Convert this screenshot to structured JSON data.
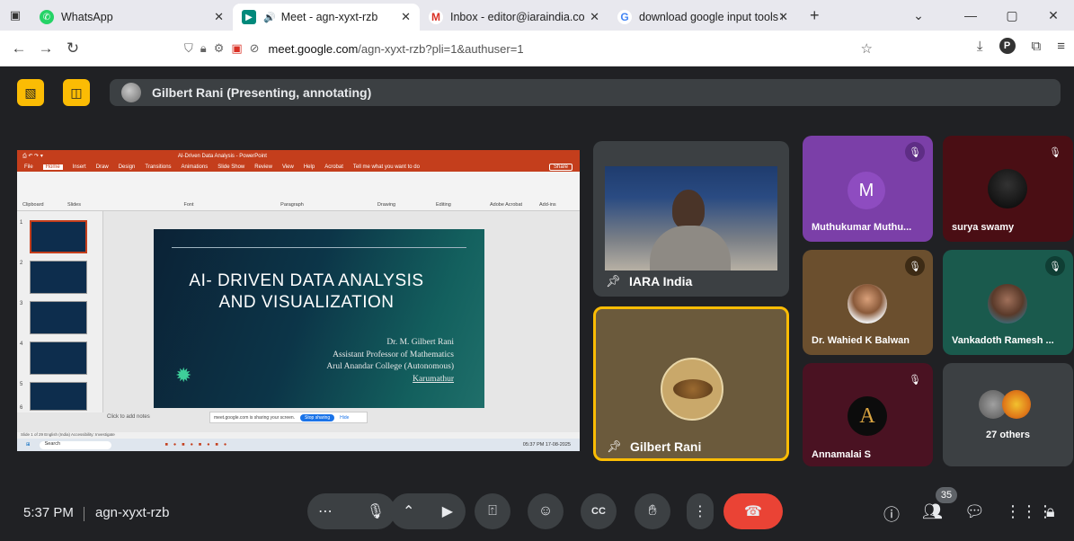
{
  "browser": {
    "tabs": [
      {
        "label": "WhatsApp",
        "active": false
      },
      {
        "label": "Meet - agn-xyxt-rzb",
        "active": true
      },
      {
        "label": "Inbox - editor@iaraindia.com - I",
        "active": false
      },
      {
        "label": "download google input tools ta",
        "active": false
      }
    ],
    "url_host": "meet.google.com",
    "url_path": "/agn-xyxt-rzb?pli=1&authuser=1",
    "profile_initial": "P"
  },
  "meet": {
    "presenter_chip": "Gilbert Rani (Presenting, annotating)",
    "time": "5:37 PM",
    "meeting_code": "agn-xyxt-rzb",
    "participant_count": "35"
  },
  "presentation": {
    "window_title": "AI-Driven Data Analysis - PowerPoint",
    "ribbon_tabs": [
      "File",
      "Home",
      "Insert",
      "Draw",
      "Design",
      "Transitions",
      "Animations",
      "Slide Show",
      "Review",
      "View",
      "Help",
      "Acrobat"
    ],
    "tell_me": "Tell me what you want to do",
    "share": "Share",
    "ribbon_groups": [
      "Clipboard",
      "Slides",
      "Font",
      "Paragraph",
      "Drawing",
      "Editing",
      "Adobe Acrobat",
      "Add-ins"
    ],
    "slide_title_line1": "AI- DRIVEN DATA ANALYSIS",
    "slide_title_line2": "AND VISUALIZATION",
    "author_lines": [
      "Dr. M. Gilbert Rani",
      "Assistant Professor of Mathematics",
      "Arul Anandar College (Autonomous)",
      "Karumathur"
    ],
    "notes_placeholder": "Click to add notes",
    "sharing_notice": "meet.google.com is sharing your screen.",
    "stop_sharing": "Stop sharing",
    "hide": "Hide",
    "status_text": "Slide 1 of 29   English (India)   Accessibility: Investigate",
    "taskbar_search": "Search",
    "taskbar_clock": "05:37 PM 17-08-2025",
    "thumb_numbers": [
      "1",
      "2",
      "3",
      "4",
      "5",
      "6"
    ]
  },
  "participants": [
    {
      "name": "IARA India"
    },
    {
      "name": "Gilbert Rani"
    },
    {
      "name": "Muthukumar Muthu...",
      "initial": "M"
    },
    {
      "name": "surya swamy"
    },
    {
      "name": "Dr. Wahied K Balwan"
    },
    {
      "name": "Vankadoth Ramesh ..."
    },
    {
      "name": "Annamalai S",
      "initial": "A"
    },
    {
      "name": "27 others"
    }
  ],
  "colors": {
    "meet_bg": "#202124",
    "accent_yellow": "#fbbc04",
    "end_call": "#ea4335",
    "purple_tile": "#7b3fa8",
    "maroon_tile": "#4a0e14",
    "brown_tile": "#6b4f2e",
    "teal_tile": "#1a5a4d",
    "wine_tile": "#4a1222"
  }
}
